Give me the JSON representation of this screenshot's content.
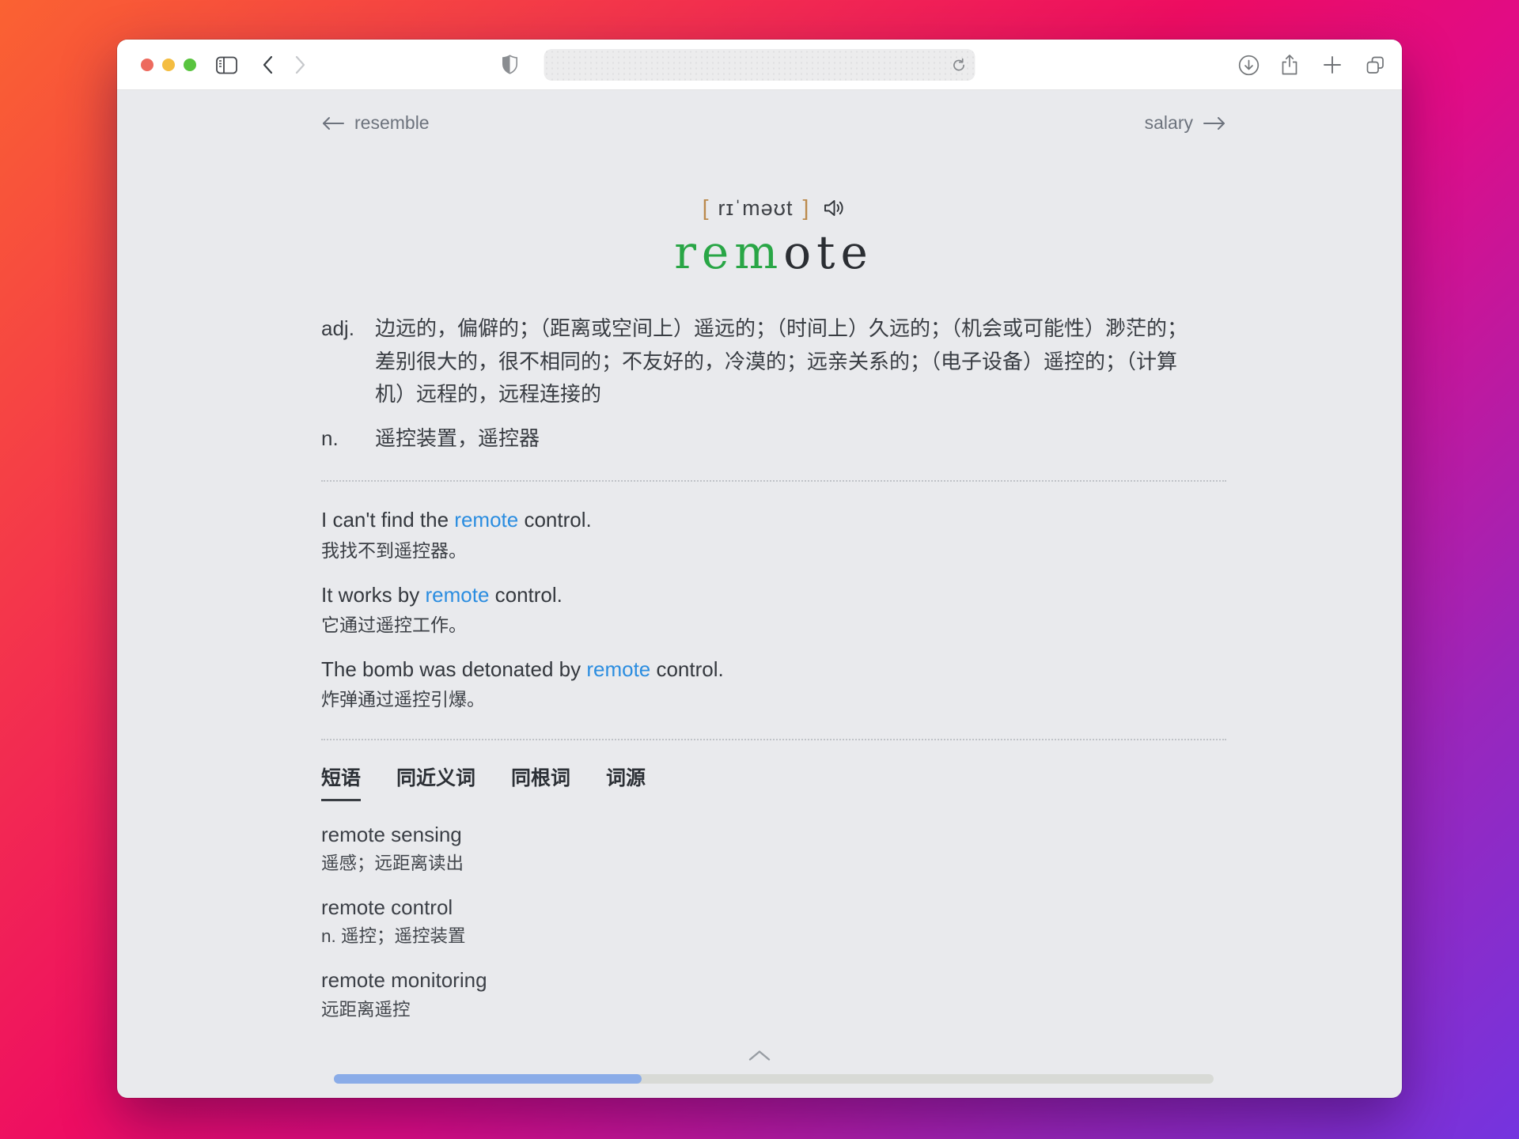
{
  "window": {
    "toolbar": {
      "traffic_lights": {
        "close": "#ed6a5e",
        "minimize": "#f4bd41",
        "zoom": "#59c43f"
      },
      "url_value": "",
      "url_placeholder": ""
    }
  },
  "nav": {
    "prev_label": "resemble",
    "next_label": "salary"
  },
  "word": {
    "bracket_left": "[",
    "phonetic": "rɪˈməʊt",
    "bracket_right": "]",
    "headword_highlight": "rem",
    "headword_rest": "ote",
    "highlight_color": "#29a646"
  },
  "definitions": [
    {
      "pos": "adj.",
      "text": "边远的，偏僻的；（距离或空间上）遥远的；（时间上）久远的；（机会或可能性）渺茫的；差别很大的，很不相同的；不友好的，冷漠的；远亲关系的；（电子设备）遥控的；（计算机）远程的，远程连接的"
    },
    {
      "pos": "n.",
      "text": "遥控装置，遥控器"
    }
  ],
  "examples": [
    {
      "en_before": "I can't find the ",
      "en_word": "remote",
      "en_after": " control.",
      "zh": "我找不到遥控器。"
    },
    {
      "en_before": "It works by ",
      "en_word": "remote",
      "en_after": " control.",
      "zh": "它通过遥控工作。"
    },
    {
      "en_before": "The bomb was detonated by ",
      "en_word": "remote",
      "en_after": " control.",
      "zh": "炸弹通过遥控引爆。"
    }
  ],
  "tabs": [
    {
      "label": "短语",
      "active": true
    },
    {
      "label": "同近义词",
      "active": false
    },
    {
      "label": "同根词",
      "active": false
    },
    {
      "label": "词源",
      "active": false
    }
  ],
  "phrases": [
    {
      "en": "remote sensing",
      "zh": "遥感；远距离读出"
    },
    {
      "en": "remote control",
      "zh": "n. 遥控；遥控装置"
    },
    {
      "en": "remote monitoring",
      "zh": "远距离遥控"
    }
  ],
  "colors": {
    "link_blue": "#2b8de0",
    "headword_green": "#29a646",
    "scroll_thumb": "#8aace8"
  },
  "scrollbar": {
    "progress_fraction": 0.35
  }
}
